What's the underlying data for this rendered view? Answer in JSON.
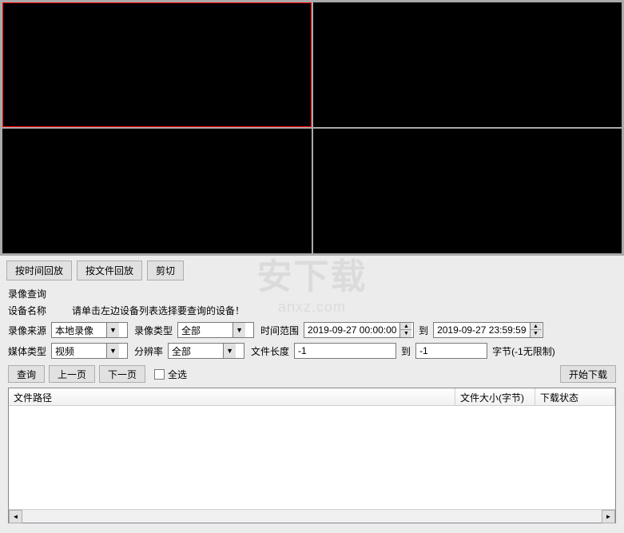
{
  "tabs": {
    "playback_by_time": "按时间回放",
    "playback_by_file": "按文件回放",
    "cut": "剪切"
  },
  "query": {
    "section_title": "录像查询",
    "device_name_label": "设备名称",
    "device_hint": "请单击左边设备列表选择要查询的设备！",
    "source_label": "录像来源",
    "source_value": "本地录像",
    "record_type_label": "录像类型",
    "record_type_value": "全部",
    "time_range_label": "时间范围",
    "time_start": "2019-09-27  00:00:00",
    "time_to": "到",
    "time_end": "2019-09-27  23:59:59",
    "media_type_label": "媒体类型",
    "media_type_value": "视频",
    "resolution_label": "分辨率",
    "resolution_value": "全部",
    "file_length_label": "文件长度",
    "file_length_from": "-1",
    "file_length_to_label": "到",
    "file_length_to": "-1",
    "bytes_unlimited": "字节(-1无限制)"
  },
  "actions": {
    "query": "查询",
    "prev_page": "上一页",
    "next_page": "下一页",
    "select_all": "全选",
    "start_download": "开始下载"
  },
  "table": {
    "col_path": "文件路径",
    "col_size": "文件大小(字节)",
    "col_status": "下载状态"
  },
  "watermark": {
    "brand": "安下载",
    "url": "anxz.com"
  }
}
